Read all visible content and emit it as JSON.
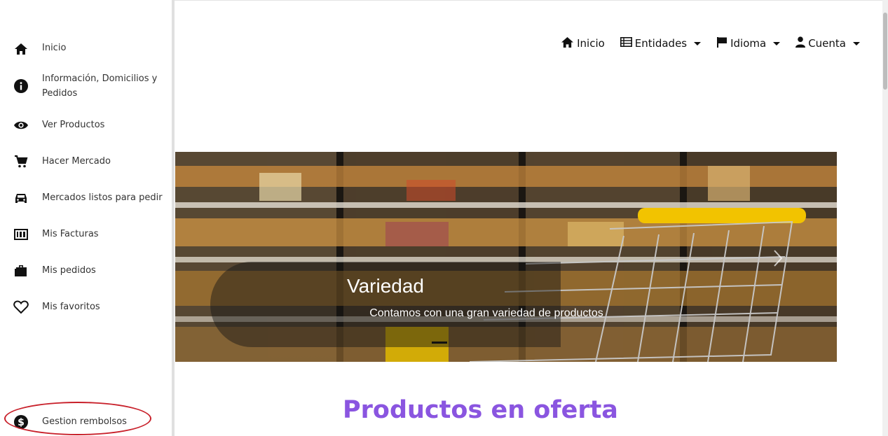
{
  "sidebar": {
    "items": [
      {
        "label": "Inicio",
        "icon": "home-icon"
      },
      {
        "label": "Información, Domicilios y Pedidos",
        "icon": "info-icon"
      },
      {
        "label": "Ver Productos",
        "icon": "eye-icon"
      },
      {
        "label": "Hacer Mercado",
        "icon": "cart-icon"
      },
      {
        "label": "Mercados listos para pedir",
        "icon": "car-icon"
      },
      {
        "label": "Mis Facturas",
        "icon": "invoice-icon"
      },
      {
        "label": "Mis pedidos",
        "icon": "briefcase-icon"
      },
      {
        "label": "Mis favoritos",
        "icon": "heart-icon"
      },
      {
        "label": "Gestion rembolsos",
        "icon": "dollar-icon"
      }
    ]
  },
  "nav": {
    "inicio": "Inicio",
    "entidades": "Entidades",
    "idioma": "Idioma",
    "cuenta": "Cuenta"
  },
  "carousel": {
    "title": "Variedad",
    "text": "Contamos con una gran variedad de productos"
  },
  "section": {
    "title": "Productos en oferta"
  },
  "colors": {
    "accent": "#8a55e0",
    "highlight": "#c8202a"
  }
}
